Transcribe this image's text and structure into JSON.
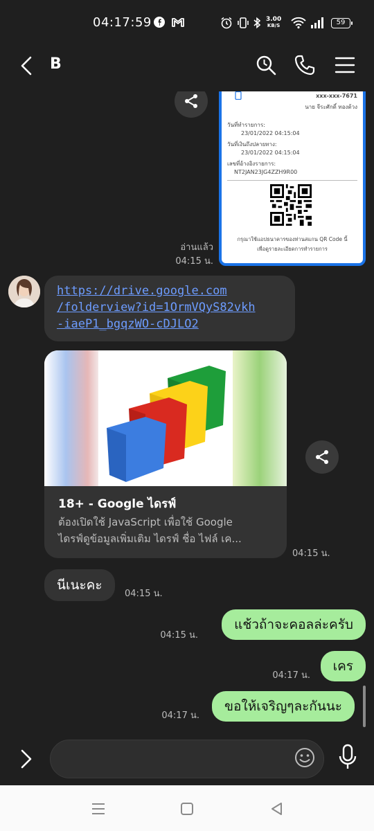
{
  "status_bar": {
    "time": "04:17:59",
    "net_speed_value": "3.00",
    "net_speed_unit": "KB/S",
    "battery": "59"
  },
  "header": {
    "title": "B"
  },
  "receipt": {
    "phone": "xxx-xxx-7671",
    "name": "นาย จีระศักดิ์ ทองด้วง",
    "date_label": "วันที่ทำรายการ:",
    "date_value": "23/01/2022 04:15:04",
    "credit_label": "วันที่เงินถึงปลายทาง:",
    "credit_value": "23/01/2022 04:15:04",
    "ref_label": "เลขที่อ้างอิงรายการ:",
    "ref_value": "NT2JAN23JG4ZZH9R00",
    "footer1": "กรุณาใช้แอปธนาคารของท่านสแกน QR Code นี้",
    "footer2": "เพื่อดูรายละเอียดการทำรายการ"
  },
  "messages": {
    "image_read": "อ่านแล้ว",
    "image_time": "04:15 น.",
    "link_line1": "https://drive.google.com",
    "link_line2": "/folderview?id=1OrmVQyS82vkh",
    "link_line3": "-iaeP1_bgqzWO-cDJLO2",
    "preview_title": "18+ - Google ไดรฟ์",
    "preview_desc_line1": "ต้องเปิดใช้ JavaScript เพื่อใช้ Google",
    "preview_desc_line2": "ไดรฟ์ดูข้อมูลเพิ่มเติม ไดรฟ์ ชื่อ ไฟล์ เค...",
    "preview_time": "04:15 น.",
    "msg_in_text": "นีเนะคะ",
    "msg_in_time": "04:15 น.",
    "out1_text": "แช้วถ้าจะคอลล่ะครับ",
    "out1_time": "04:15 น.",
    "out2_text": "เคร",
    "out2_time": "04:17 น.",
    "out3_text": "ขอให้เจริญๆละกันนะ",
    "out3_time": "04:17 น."
  },
  "composer": {
    "placeholder": ""
  },
  "icons": {
    "back": "chevron-left-icon",
    "search": "search-icon",
    "call": "phone-icon",
    "menu": "hamburger-icon",
    "share": "share-icon",
    "emoji": "emoji-icon",
    "mic": "mic-icon"
  },
  "colors": {
    "background": "#1f1f1f",
    "bubble_in": "#333333",
    "bubble_out": "#a6ec9c",
    "link": "#6d9cff",
    "receipt_border": "#1a73e8"
  }
}
